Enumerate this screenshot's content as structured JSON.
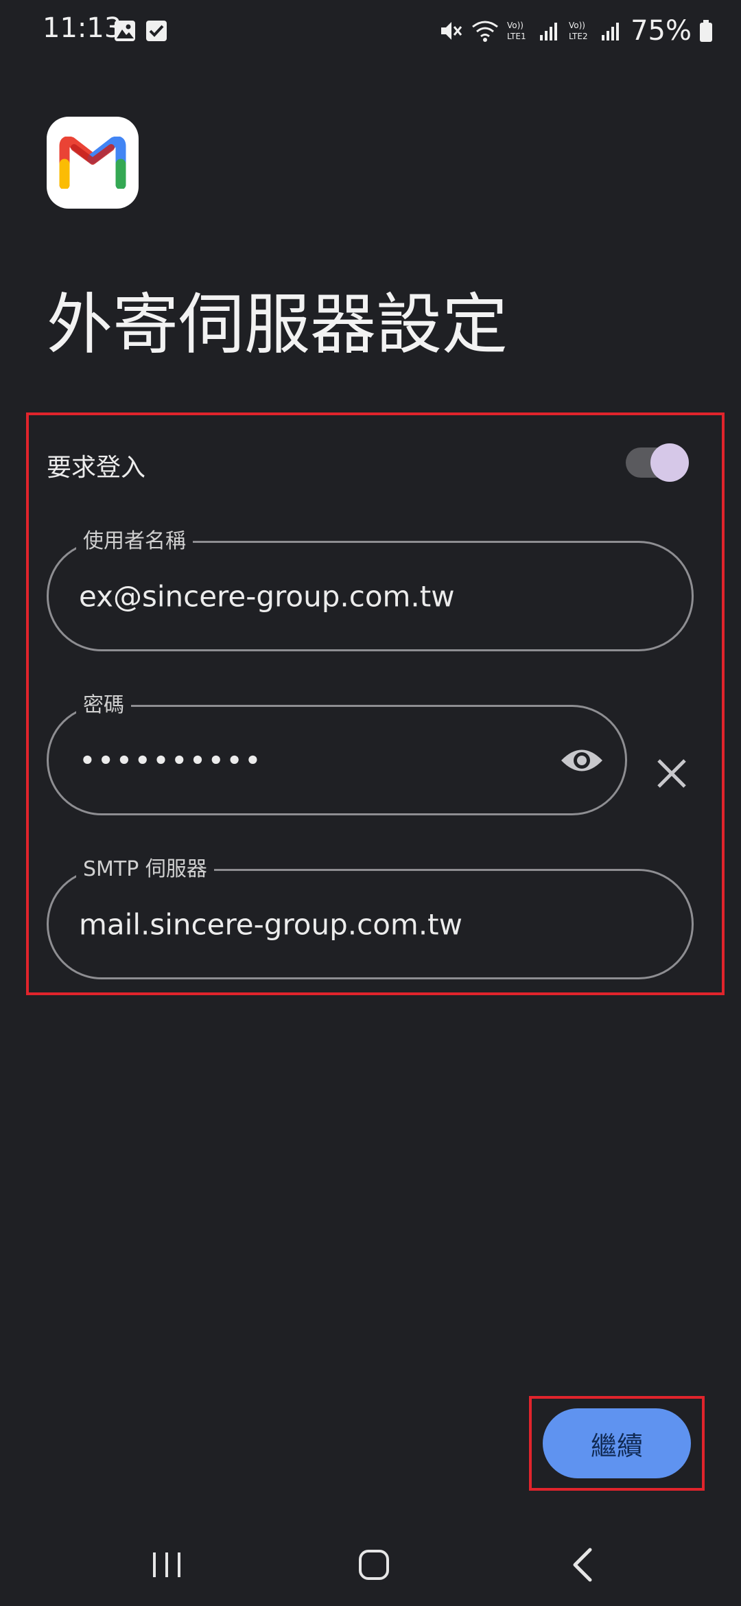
{
  "status_bar": {
    "time": "11:13",
    "battery": "75%"
  },
  "header": {
    "title": "外寄伺服器設定",
    "logo_icon": "gmail-logo-icon"
  },
  "form": {
    "require_login_label": "要求登入",
    "require_login_on": true,
    "username": {
      "label": "使用者名稱",
      "value": "ex@sincere-group.com.tw"
    },
    "password": {
      "label": "密碼",
      "value": "••••••••••",
      "visibility_icon": "eye-icon",
      "clear_icon": "close-icon"
    },
    "smtp": {
      "label": "SMTP 伺服器",
      "value": "mail.sincere-group.com.tw"
    }
  },
  "actions": {
    "continue_label": "繼續"
  },
  "colors": {
    "background": "#1f2024",
    "accent": "#5f93f0",
    "highlight": "#e0242c",
    "toggle_knob": "#d6c8e8"
  },
  "nav": {
    "recent_icon": "recent-apps-icon",
    "home_icon": "home-icon",
    "back_icon": "back-icon"
  }
}
